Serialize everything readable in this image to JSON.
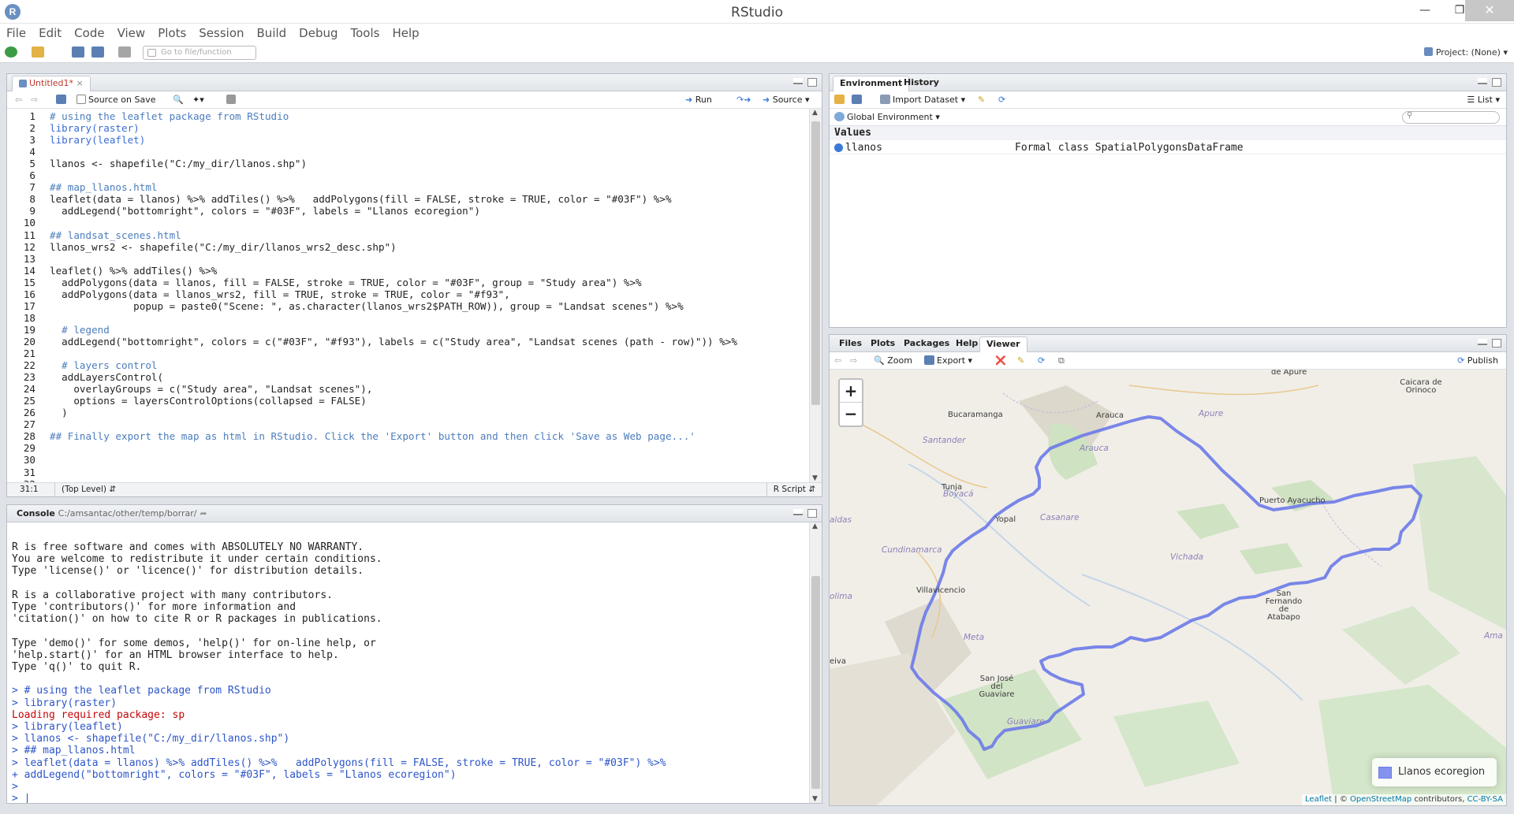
{
  "window": {
    "title": "RStudio",
    "app_icon": "R"
  },
  "menu": [
    "File",
    "Edit",
    "Code",
    "View",
    "Plots",
    "Session",
    "Build",
    "Debug",
    "Tools",
    "Help"
  ],
  "toolbar": {
    "goto_placeholder": "Go to file/function",
    "project_label": "Project: (None)"
  },
  "editor": {
    "tab_label": "Untitled1*",
    "source_on_save": "Source on Save",
    "run_label": "Run",
    "source_label": "Source",
    "status_position": "31:1",
    "status_scope": "(Top Level)",
    "status_lang": "R Script",
    "lines": [
      {
        "n": "1",
        "t": "# using the leaflet package from RStudio",
        "c": "cm"
      },
      {
        "n": "2",
        "t": "library(raster)",
        "c": "kw"
      },
      {
        "n": "3",
        "t": "library(leaflet)",
        "c": "kw"
      },
      {
        "n": "4",
        "t": "",
        "c": "fn"
      },
      {
        "n": "5",
        "t": "llanos <- shapefile(\"C:/my_dir/llanos.shp\")",
        "c": "fn"
      },
      {
        "n": "6",
        "t": "",
        "c": "fn"
      },
      {
        "n": "7",
        "t": "## map_llanos.html",
        "c": "cm"
      },
      {
        "n": "8",
        "t": "leaflet(data = llanos) %>% addTiles() %>%   addPolygons(fill = FALSE, stroke = TRUE, color = \"#03F\") %>%",
        "c": "fn"
      },
      {
        "n": "9",
        "t": "  addLegend(\"bottomright\", colors = \"#03F\", labels = \"Llanos ecoregion\")",
        "c": "fn"
      },
      {
        "n": "10",
        "t": "",
        "c": "fn"
      },
      {
        "n": "11",
        "t": "## landsat_scenes.html",
        "c": "cm"
      },
      {
        "n": "12",
        "t": "llanos_wrs2 <- shapefile(\"C:/my_dir/llanos_wrs2_desc.shp\")",
        "c": "fn"
      },
      {
        "n": "13",
        "t": "",
        "c": "fn"
      },
      {
        "n": "14",
        "t": "leaflet() %>% addTiles() %>%",
        "c": "fn"
      },
      {
        "n": "15",
        "t": "  addPolygons(data = llanos, fill = FALSE, stroke = TRUE, color = \"#03F\", group = \"Study area\") %>%",
        "c": "fn"
      },
      {
        "n": "16",
        "t": "  addPolygons(data = llanos_wrs2, fill = TRUE, stroke = TRUE, color = \"#f93\",",
        "c": "fn"
      },
      {
        "n": "17",
        "t": "              popup = paste0(\"Scene: \", as.character(llanos_wrs2$PATH_ROW)), group = \"Landsat scenes\") %>%",
        "c": "fn"
      },
      {
        "n": "18",
        "t": "",
        "c": "fn"
      },
      {
        "n": "19",
        "t": "  # legend",
        "c": "cm"
      },
      {
        "n": "20",
        "t": "  addLegend(\"bottomright\", colors = c(\"#03F\", \"#f93\"), labels = c(\"Study area\", \"Landsat scenes (path - row)\")) %>%",
        "c": "fn"
      },
      {
        "n": "21",
        "t": "",
        "c": "fn"
      },
      {
        "n": "22",
        "t": "  # layers control",
        "c": "cm"
      },
      {
        "n": "23",
        "t": "  addLayersControl(",
        "c": "fn"
      },
      {
        "n": "24",
        "t": "    overlayGroups = c(\"Study area\", \"Landsat scenes\"),",
        "c": "fn"
      },
      {
        "n": "25",
        "t": "    options = layersControlOptions(collapsed = FALSE)",
        "c": "fn"
      },
      {
        "n": "26",
        "t": "  )",
        "c": "fn"
      },
      {
        "n": "27",
        "t": "",
        "c": "fn"
      },
      {
        "n": "28",
        "t": "## Finally export the map as html in RStudio. Click the 'Export' button and then click 'Save as Web page...'",
        "c": "cm"
      },
      {
        "n": "29",
        "t": "",
        "c": "fn"
      },
      {
        "n": "30",
        "t": "",
        "c": "fn"
      },
      {
        "n": "31",
        "t": "",
        "c": "fn"
      },
      {
        "n": "32",
        "t": "",
        "c": "fn"
      }
    ]
  },
  "console": {
    "tab_label": "Console",
    "path": "C:/amsantac/other/temp/borrar/",
    "lines": [
      {
        "t": "R is free software and comes with ABSOLUTELY NO WARRANTY.",
        "c": "out"
      },
      {
        "t": "You are welcome to redistribute it under certain conditions.",
        "c": "out"
      },
      {
        "t": "Type 'license()' or 'licence()' for distribution details.",
        "c": "out"
      },
      {
        "t": "",
        "c": "out"
      },
      {
        "t": "R is a collaborative project with many contributors.",
        "c": "out"
      },
      {
        "t": "Type 'contributors()' for more information and",
        "c": "out"
      },
      {
        "t": "'citation()' on how to cite R or R packages in publications.",
        "c": "out"
      },
      {
        "t": "",
        "c": "out"
      },
      {
        "t": "Type 'demo()' for some demos, 'help()' for on-line help, or",
        "c": "out"
      },
      {
        "t": "'help.start()' for an HTML browser interface to help.",
        "c": "out"
      },
      {
        "t": "Type 'q()' to quit R.",
        "c": "out"
      },
      {
        "t": "",
        "c": "out"
      },
      {
        "t": "> # using the leaflet package from RStudio",
        "c": "in"
      },
      {
        "t": "> library(raster)",
        "c": "in"
      },
      {
        "t": "Loading required package: sp",
        "c": "err"
      },
      {
        "t": "> library(leaflet)",
        "c": "in"
      },
      {
        "t": "> llanos <- shapefile(\"C:/my_dir/llanos.shp\")",
        "c": "in"
      },
      {
        "t": "> ## map_llanos.html",
        "c": "in"
      },
      {
        "t": "> leaflet(data = llanos) %>% addTiles() %>%   addPolygons(fill = FALSE, stroke = TRUE, color = \"#03F\") %>%",
        "c": "in"
      },
      {
        "t": "+ addLegend(\"bottomright\", colors = \"#03F\", labels = \"Llanos ecoregion\")",
        "c": "in"
      },
      {
        "t": ">",
        "c": "in"
      },
      {
        "t": "> |",
        "c": "in"
      }
    ]
  },
  "environment": {
    "tabs": [
      "Environment",
      "History"
    ],
    "import_label": "Import Dataset",
    "list_label": "List",
    "scope_label": "Global Environment",
    "values_header": "Values",
    "rows": [
      {
        "name": "llanos",
        "value": "Formal class SpatialPolygonsDataFrame"
      }
    ]
  },
  "viewer": {
    "tabs": [
      "Files",
      "Plots",
      "Packages",
      "Help",
      "Viewer"
    ],
    "zoom_label": "Zoom",
    "export_label": "Export",
    "publish_label": "Publish",
    "zoom_in": "+",
    "zoom_out": "−",
    "legend_label": "Llanos ecoregion",
    "legend_color": "#8593f0",
    "polygon_color": "#6b7ae8",
    "attribution": {
      "leaflet": "Leaflet",
      "sep1": " | © ",
      "osm": "OpenStreetMap",
      "sep2": " contributors, ",
      "license": "CC-BY-SA"
    },
    "places": [
      {
        "name": "de Apure",
        "kind": "city"
      },
      {
        "name": "Caicara de Orinoco",
        "kind": "city"
      },
      {
        "name": "Bucaramanga",
        "kind": "city"
      },
      {
        "name": "Arauca",
        "kind": "city"
      },
      {
        "name": "Apure",
        "kind": "region"
      },
      {
        "name": "Santander",
        "kind": "region"
      },
      {
        "name": "Arauca",
        "kind": "region"
      },
      {
        "name": "Boyacá",
        "kind": "region"
      },
      {
        "name": "Puerto Ayacucho",
        "kind": "city"
      },
      {
        "name": "Tunja",
        "kind": "city"
      },
      {
        "name": "Yopal",
        "kind": "city"
      },
      {
        "name": "Casanare",
        "kind": "region"
      },
      {
        "name": "aldas",
        "kind": "region"
      },
      {
        "name": "Cundinamarca",
        "kind": "region"
      },
      {
        "name": "Vichada",
        "kind": "region"
      },
      {
        "name": "olima",
        "kind": "region"
      },
      {
        "name": "Villavicencio",
        "kind": "city"
      },
      {
        "name": "San Fernando de Atabapo",
        "kind": "city"
      },
      {
        "name": "Meta",
        "kind": "region"
      },
      {
        "name": "Ama",
        "kind": "region"
      },
      {
        "name": "eiva",
        "kind": "city"
      },
      {
        "name": "San José del Guaviare",
        "kind": "city"
      },
      {
        "name": "Guaviare",
        "kind": "region"
      }
    ]
  }
}
